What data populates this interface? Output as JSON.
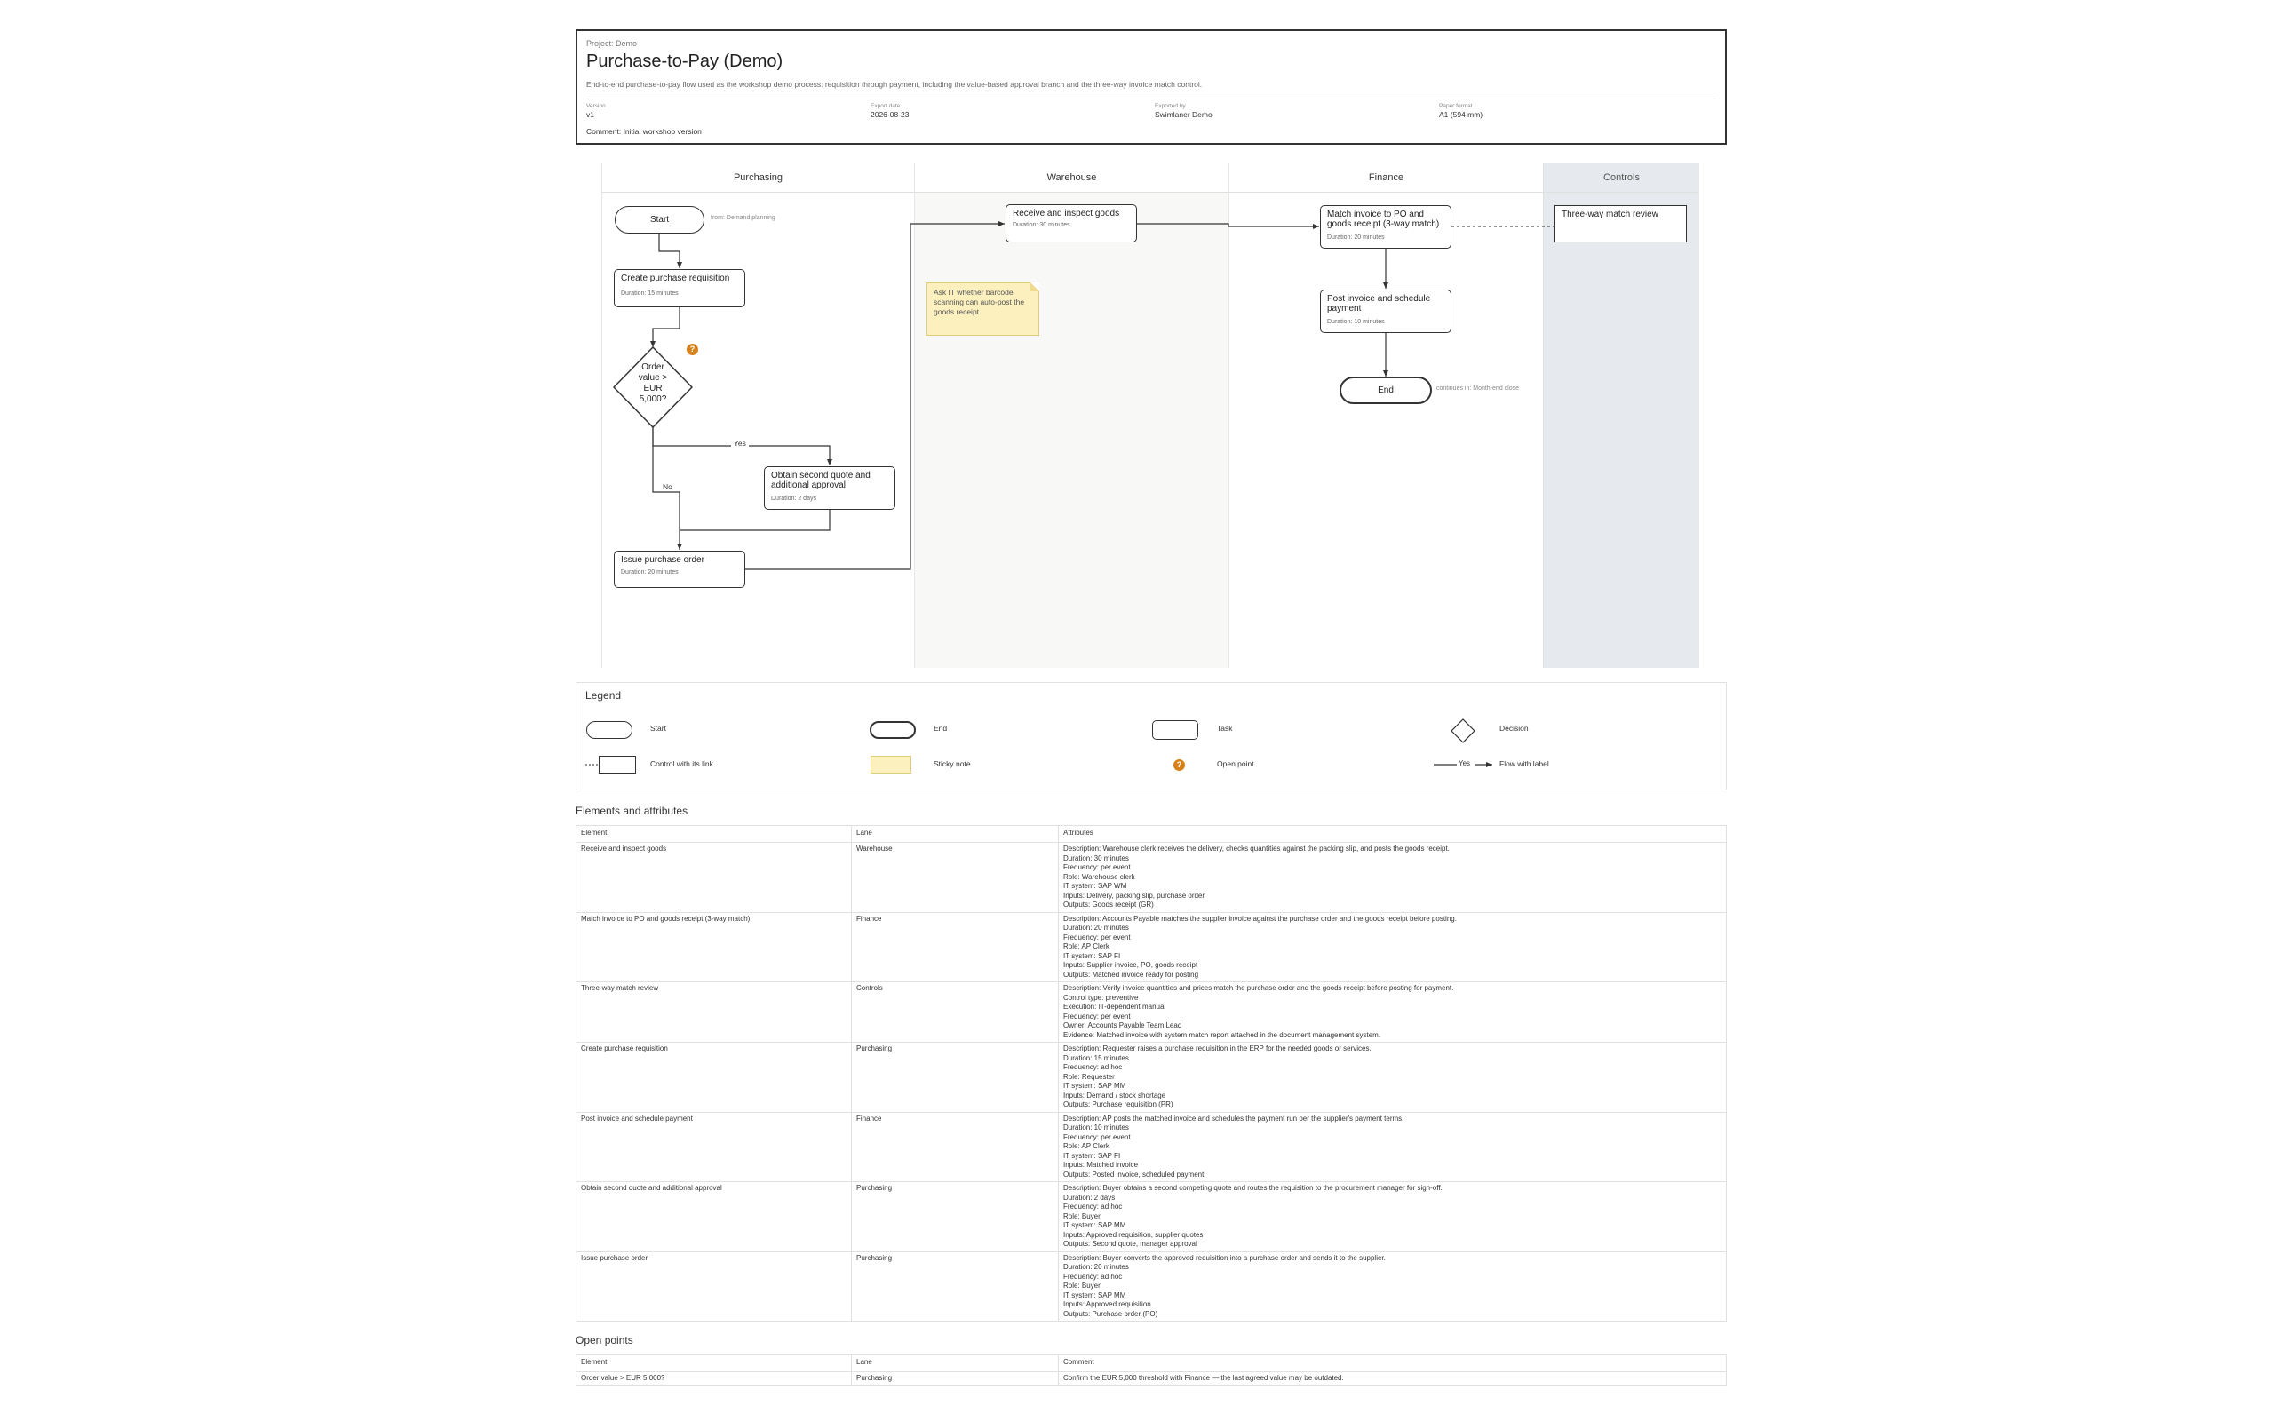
{
  "header": {
    "project": "Project: Demo",
    "title": "Purchase-to-Pay (Demo)",
    "description": "End-to-end purchase-to-pay flow used as the workshop demo process: requisition through payment, including the value-based approval branch and the three-way invoice match control.",
    "meta": [
      {
        "label": "Version",
        "value": "v1"
      },
      {
        "label": "Export date",
        "value": "2026-08-23"
      },
      {
        "label": "Exported by",
        "value": "Swimlaner Demo"
      },
      {
        "label": "Paper format",
        "value": "A1 (594 mm)"
      }
    ],
    "comment": "Comment: Initial workshop version"
  },
  "lanes": [
    {
      "name": "Purchasing"
    },
    {
      "name": "Warehouse"
    },
    {
      "name": "Finance"
    },
    {
      "name": "Controls"
    }
  ],
  "diagram": {
    "start": {
      "label": "Start",
      "note": "from: Demand planning"
    },
    "create_pr": {
      "title": "Create purchase requisition",
      "duration": "Duration: 15 minutes"
    },
    "decision": {
      "line1": "Order",
      "line2": "value >",
      "line3": "EUR",
      "line4": "5,000?",
      "open_point_marker": "?"
    },
    "yes_label": "Yes",
    "no_label": "No",
    "second_quote": {
      "title": "Obtain second quote and additional approval",
      "duration": "Duration: 2 days"
    },
    "issue_po": {
      "title": "Issue purchase order",
      "duration": "Duration: 20 minutes"
    },
    "receive": {
      "title": "Receive and inspect goods",
      "duration": "Duration: 30 minutes"
    },
    "sticky": {
      "text": "Ask IT whether barcode scanning can auto-post the goods receipt."
    },
    "match": {
      "title": "Match invoice to PO and goods receipt (3-way match)",
      "duration": "Duration: 20 minutes"
    },
    "post": {
      "title": "Post invoice and schedule payment",
      "duration": "Duration: 10 minutes"
    },
    "end": {
      "label": "End",
      "note": "continues in: Month-end close"
    },
    "control": {
      "title": "Three-way match review"
    }
  },
  "legend": {
    "title": "Legend",
    "items": {
      "start": "Start",
      "end": "End",
      "task": "Task",
      "decision": "Decision",
      "control": "Control with its link",
      "sticky": "Sticky note",
      "open_point": "Open point",
      "flow": "Flow with label",
      "flow_sample": "Yes",
      "open_point_marker": "?"
    }
  },
  "elements_table": {
    "title": "Elements and attributes",
    "columns": [
      "Element",
      "Lane",
      "Attributes"
    ],
    "rows": [
      {
        "element": "Receive and inspect goods",
        "lane": "Warehouse",
        "attributes": [
          "Description: Warehouse clerk receives the delivery, checks quantities against the packing slip, and posts the goods receipt.",
          "Duration: 30 minutes",
          "Frequency: per event",
          "Role: Warehouse clerk",
          "IT system: SAP WM",
          "Inputs: Delivery, packing slip, purchase order",
          "Outputs: Goods receipt (GR)"
        ]
      },
      {
        "element": "Match invoice to PO and goods receipt (3-way match)",
        "lane": "Finance",
        "attributes": [
          "Description: Accounts Payable matches the supplier invoice against the purchase order and the goods receipt before posting.",
          "Duration: 20 minutes",
          "Frequency: per event",
          "Role: AP Clerk",
          "IT system: SAP FI",
          "Inputs: Supplier invoice, PO, goods receipt",
          "Outputs: Matched invoice ready for posting"
        ]
      },
      {
        "element": "Three-way match review",
        "lane": "Controls",
        "attributes": [
          "Description: Verify invoice quantities and prices match the purchase order and the goods receipt before posting for payment.",
          "Control type: preventive",
          "Execution: IT-dependent manual",
          "Frequency: per event",
          "Owner: Accounts Payable Team Lead",
          "Evidence: Matched invoice with system match report attached in the document management system."
        ]
      },
      {
        "element": "Create purchase requisition",
        "lane": "Purchasing",
        "attributes": [
          "Description: Requester raises a purchase requisition in the ERP for the needed goods or services.",
          "Duration: 15 minutes",
          "Frequency: ad hoc",
          "Role: Requester",
          "IT system: SAP MM",
          "Inputs: Demand / stock shortage",
          "Outputs: Purchase requisition (PR)"
        ]
      },
      {
        "element": "Post invoice and schedule payment",
        "lane": "Finance",
        "attributes": [
          "Description: AP posts the matched invoice and schedules the payment run per the supplier's payment terms.",
          "Duration: 10 minutes",
          "Frequency: per event",
          "Role: AP Clerk",
          "IT system: SAP FI",
          "Inputs: Matched invoice",
          "Outputs: Posted invoice, scheduled payment"
        ]
      },
      {
        "element": "Obtain second quote and additional approval",
        "lane": "Purchasing",
        "attributes": [
          "Description: Buyer obtains a second competing quote and routes the requisition to the procurement manager for sign-off.",
          "Duration: 2 days",
          "Frequency: ad hoc",
          "Role: Buyer",
          "IT system: SAP MM",
          "Inputs: Approved requisition, supplier quotes",
          "Outputs: Second quote, manager approval"
        ]
      },
      {
        "element": "Issue purchase order",
        "lane": "Purchasing",
        "attributes": [
          "Description: Buyer converts the approved requisition into a purchase order and sends it to the supplier.",
          "Duration: 20 minutes",
          "Frequency: ad hoc",
          "Role: Buyer",
          "IT system: SAP MM",
          "Inputs: Approved requisition",
          "Outputs: Purchase order (PO)"
        ]
      }
    ]
  },
  "open_points": {
    "title": "Open points",
    "columns": [
      "Element",
      "Lane",
      "Comment"
    ],
    "rows": [
      {
        "element": "Order value > EUR 5,000?",
        "lane": "Purchasing",
        "comment": "Confirm the EUR 5,000 threshold with Finance — the last agreed value may be outdated."
      }
    ]
  },
  "colors": {
    "control_lane": "#e6eaee",
    "warehouse_lane": "#f8f8f6",
    "sticky": "#fdf0bf",
    "open_point": "#d9821b"
  }
}
